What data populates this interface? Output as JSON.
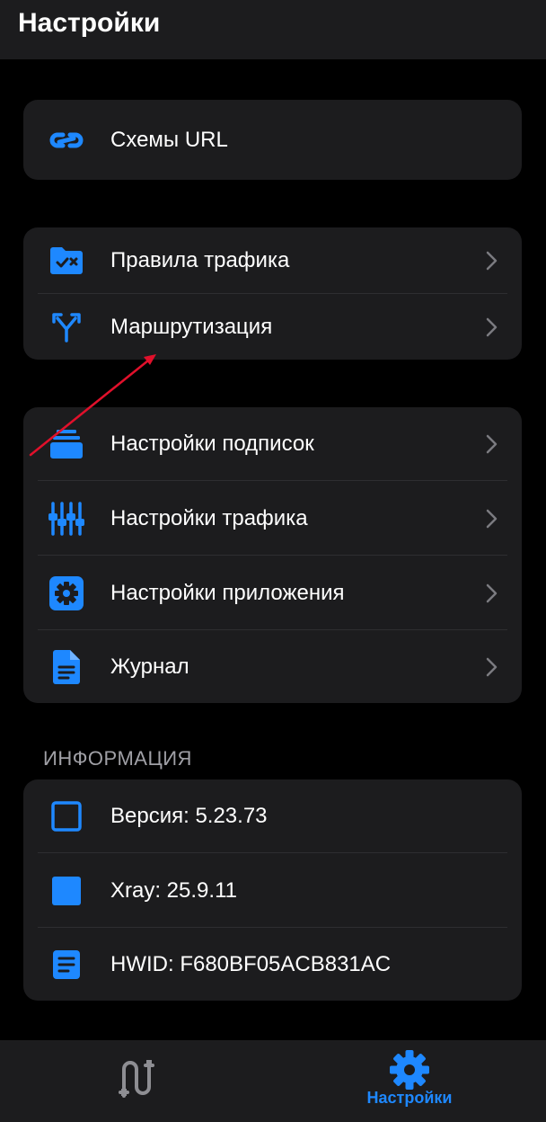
{
  "header": {
    "title": "Настройки"
  },
  "groups": {
    "url": [
      {
        "label": "Схемы URL",
        "icon": "link-icon"
      }
    ],
    "rules": [
      {
        "label": "Правила трафика",
        "icon": "folder-rules-icon"
      },
      {
        "label": "Маршрутизация",
        "icon": "route-split-icon"
      }
    ],
    "settings": [
      {
        "label": "Настройки подписок",
        "icon": "subscriptions-icon"
      },
      {
        "label": "Настройки трафика",
        "icon": "equalizer-icon"
      },
      {
        "label": "Настройки приложения",
        "icon": "gear-square-icon"
      },
      {
        "label": "Журнал",
        "icon": "document-icon"
      }
    ],
    "info": [
      {
        "label": "Версия: 5.23.73",
        "icon": "square-outline-icon"
      },
      {
        "label": "Xray: 25.9.11",
        "icon": "square-filled-icon"
      },
      {
        "label": "HWID: F680BF05ACB831AC",
        "icon": "document-lines-icon"
      }
    ]
  },
  "info_section_title": "ИНФОРМАЦИЯ",
  "nav": {
    "items": [
      {
        "label": "",
        "icon": "connection-icon",
        "active": false
      },
      {
        "label": "Настройки",
        "icon": "gear-icon",
        "active": true
      }
    ]
  },
  "colors": {
    "accent": "#1e88ff",
    "background": "#000000",
    "card": "#1c1c1e",
    "annotation": "#e0102b"
  }
}
